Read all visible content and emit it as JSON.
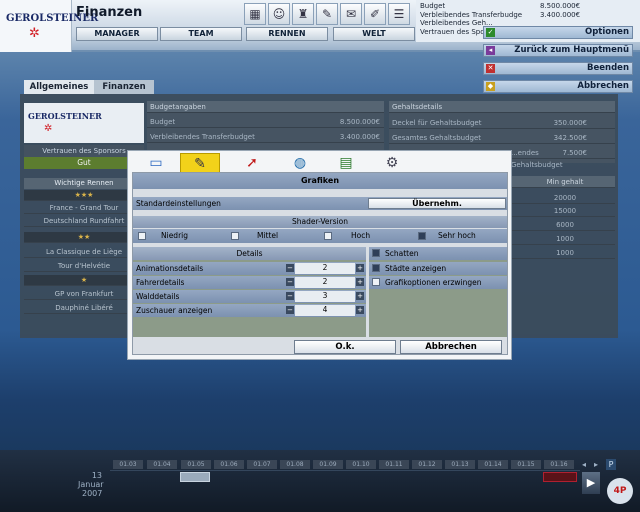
{
  "header": {
    "logo_text": "GEROLSTEINER",
    "title": "Finanzen",
    "nav": [
      "MANAGER",
      "TEAM",
      "RENNEN",
      "WELT"
    ],
    "budget_rows": [
      {
        "label": "Budget",
        "value": "8.500.000€"
      },
      {
        "label": "Verbleibendes Transferbudge",
        "value": "3.400.000€"
      },
      {
        "label": "Verbleibendes Geh...",
        "value": ""
      },
      {
        "label": "Vertrauen des Spon...",
        "value": ""
      }
    ]
  },
  "side_buttons": [
    {
      "label": "Optionen",
      "icon": "check-icon",
      "color": "#2c8a2c"
    },
    {
      "label": "Zurück zum Hauptmenü",
      "icon": "menu-icon",
      "color": "#7a3a9a"
    },
    {
      "label": "Beenden",
      "icon": "close-icon",
      "color": "#c03030"
    },
    {
      "label": "Abbrechen",
      "icon": "cancel-icon",
      "color": "#c8a020"
    }
  ],
  "tabs": [
    "Allgemeines",
    "Finanzen"
  ],
  "left_panel": {
    "logo_text": "GEROLSTEINER",
    "trust_label": "Vertrauen des Sponsors",
    "trust_value": "Gut",
    "races_header": "Wichtige Rennen",
    "rows": [
      {
        "text": "★★★",
        "type": "stars"
      },
      {
        "text": "France - Grand Tour",
        "type": "race"
      },
      {
        "text": "Deutschland Rundfahrt",
        "type": "race"
      },
      {
        "text": "★★",
        "type": "stars"
      },
      {
        "text": "La Classique de Liège",
        "type": "race"
      },
      {
        "text": "Tour d'Helvétie",
        "type": "race"
      },
      {
        "text": "★",
        "type": "stars"
      },
      {
        "text": "GP von Frankfurt",
        "type": "race"
      },
      {
        "text": "Dauphiné Libéré",
        "type": "race"
      }
    ]
  },
  "budget_panel": {
    "title": "Budgetangaben",
    "rows": [
      {
        "label": "Budget",
        "value": "8.500.000€"
      },
      {
        "label": "Verbleibendes Transferbudget",
        "value": "3.400.000€"
      }
    ]
  },
  "salary_panel": {
    "title": "Gehaltsdetails",
    "rows": [
      {
        "label": "Deckel für Gehaltsbudget",
        "value": "350.000€"
      },
      {
        "label": "Gesamtes Gehaltsbudget",
        "value": "342.500€"
      },
      {
        "label": "...endes Gehaltsbudget",
        "value": "7.500€"
      }
    ],
    "min_header": "Min gehalt",
    "min_values": [
      "20000",
      "15000",
      "6000",
      "1000",
      "1000"
    ]
  },
  "dialog": {
    "title": "Grafiken",
    "tab_icons": [
      "monitor-icon",
      "paint-icon",
      "mouse-icon",
      "globe-icon",
      "money-icon",
      "bike-icon"
    ],
    "standard_label": "Standardeinstellungen",
    "apply_label": "Übernehm.",
    "shader_title": "Shader-Version",
    "shader_options": [
      {
        "label": "Niedrig",
        "checked": false
      },
      {
        "label": "Mittel",
        "checked": false
      },
      {
        "label": "Hoch",
        "checked": false
      },
      {
        "label": "Sehr hoch",
        "checked": true
      }
    ],
    "details_title": "Details",
    "details": [
      {
        "label": "Animationsdetails",
        "value": "2"
      },
      {
        "label": "Fahrerdetails",
        "value": "2"
      },
      {
        "label": "Walddetails",
        "value": "3"
      },
      {
        "label": "Zuschauer anzeigen",
        "value": "4"
      }
    ],
    "checkboxes": [
      {
        "label": "Schatten",
        "checked": true
      },
      {
        "label": "Städte anzeigen",
        "checked": true
      },
      {
        "label": "Grafikoptionen erzwingen",
        "checked": false
      }
    ],
    "ok_label": "O.k.",
    "cancel_label": "Abbrechen"
  },
  "timeline": {
    "day": "13",
    "month": "Januar",
    "year": "2007",
    "weeks": [
      "01.03",
      "01.04",
      "01.05",
      "01.06",
      "01.07",
      "01.08",
      "01.09",
      "01.10",
      "01.11",
      "01.12",
      "01.13",
      "01.14",
      "01.15",
      "01.16"
    ]
  }
}
